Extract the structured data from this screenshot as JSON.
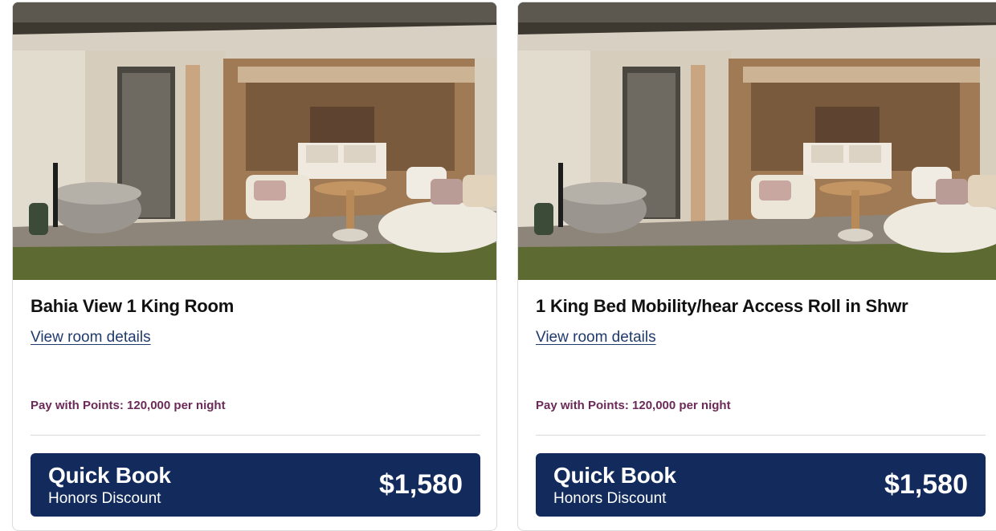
{
  "rooms": [
    {
      "image_alt": "Room photo",
      "title": "Bahia View 1 King Room",
      "details_link": "View room details",
      "points_text": "Pay with Points: 120,000 per night",
      "quick_book": {
        "label": "Quick Book",
        "rate_name": "Honors Discount",
        "price": "$1,580"
      }
    },
    {
      "image_alt": "Room photo",
      "title": "1 King Bed Mobility/hear Access Roll in Shwr",
      "details_link": "View room details",
      "points_text": "Pay with Points: 120,000 per night",
      "quick_book": {
        "label": "Quick Book",
        "rate_name": "Honors Discount",
        "price": "$1,580"
      }
    }
  ],
  "colors": {
    "button_bg": "#122b5c",
    "link": "#1f3a6d",
    "points_text": "#6b2a57"
  }
}
